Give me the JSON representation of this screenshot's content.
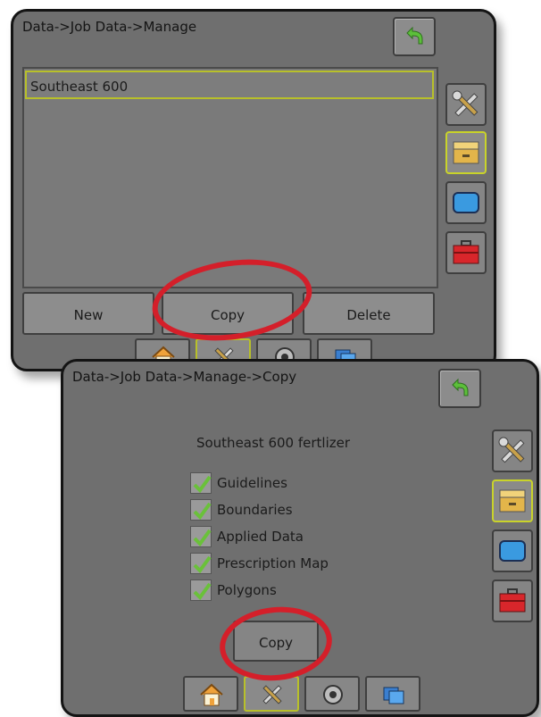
{
  "screen1": {
    "breadcrumb": "Data->Job Data->Manage",
    "jobs": [
      "Southeast 600"
    ],
    "buttons": {
      "new": "New",
      "copy": "Copy",
      "delete": "Delete"
    }
  },
  "screen2": {
    "breadcrumb": "Data->Job Data->Manage->Copy",
    "job_name": "Southeast 600 fertlizer",
    "options": [
      {
        "label": "Guidelines",
        "checked": true
      },
      {
        "label": "Boundaries",
        "checked": true
      },
      {
        "label": "Applied Data",
        "checked": true
      },
      {
        "label": "Prescription Map",
        "checked": true
      },
      {
        "label": "Polygons",
        "checked": true
      }
    ],
    "copy_button": "Copy"
  },
  "side_tabs": [
    "tools-icon",
    "job-data-icon",
    "display-icon",
    "toolbox-icon"
  ],
  "nav_tabs": [
    "home-icon",
    "tools-icon",
    "gps-icon",
    "layers-icon"
  ],
  "colors": {
    "screen_bg": "#6f6f6f",
    "selected_border": "#c9d32a",
    "highlight": "#d41f2a",
    "check_green": "#6ac13a"
  }
}
